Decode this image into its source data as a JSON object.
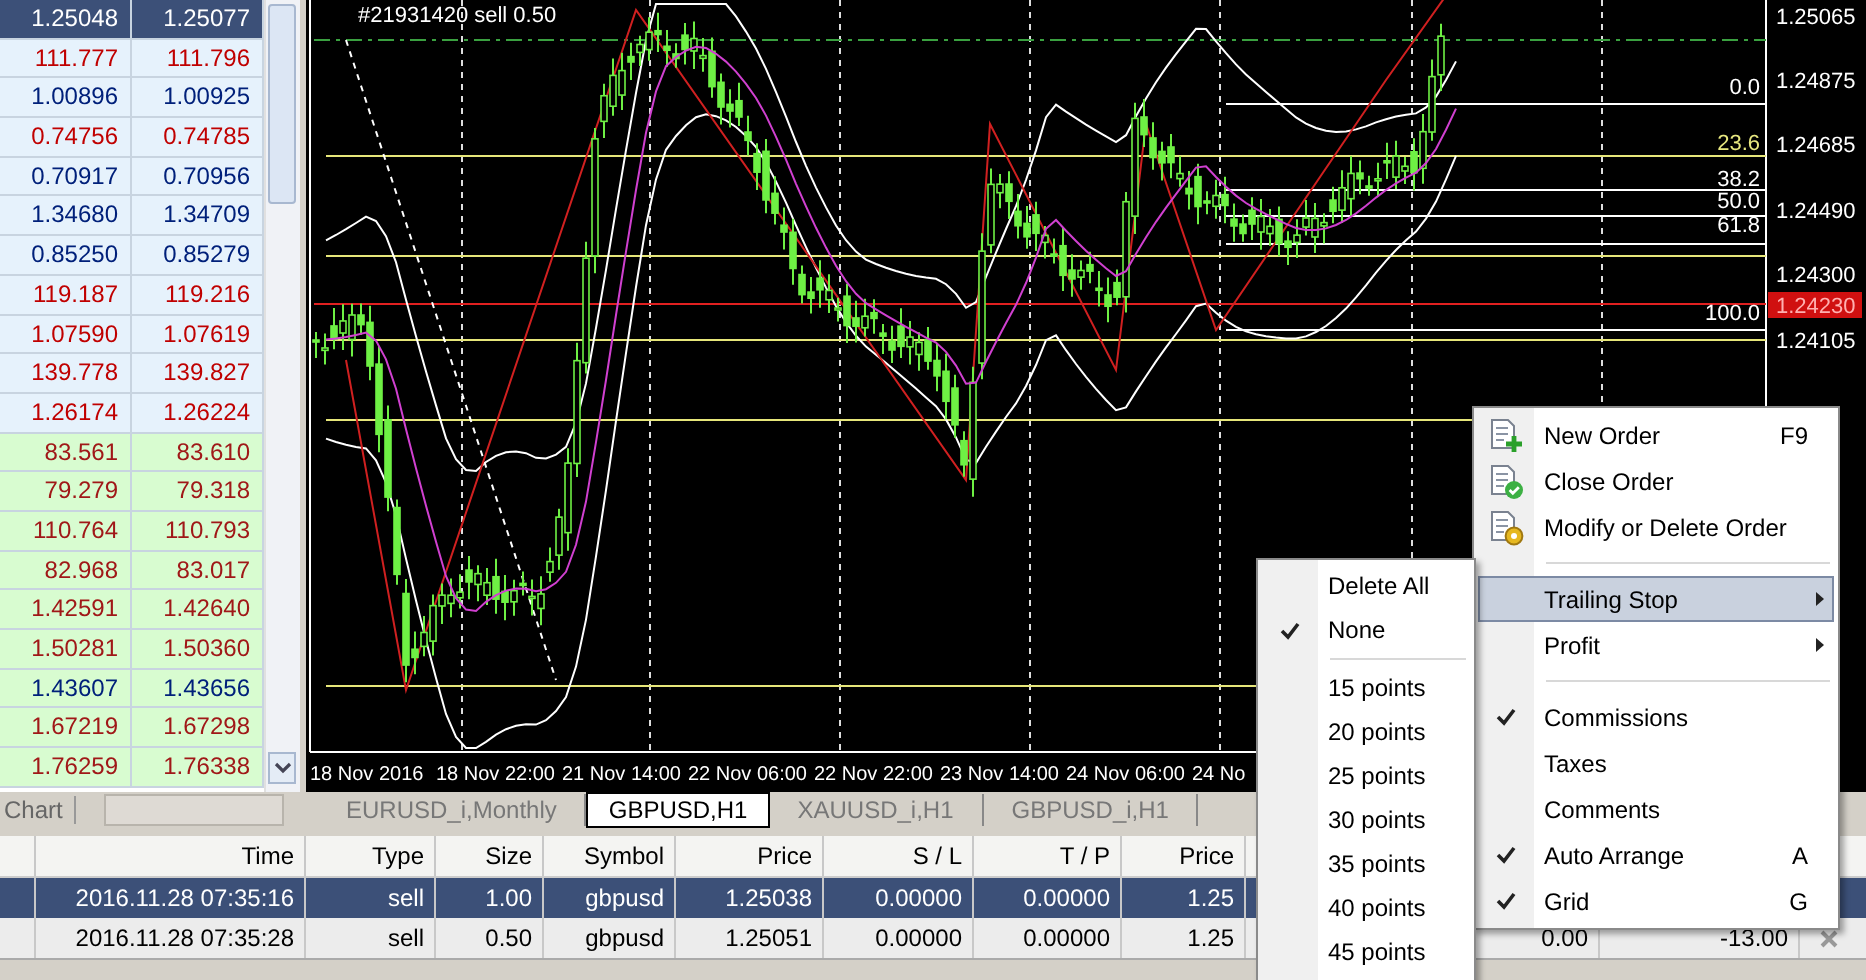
{
  "market_watch": {
    "quotes": [
      {
        "bid": "1.25048",
        "ask": "1.25077",
        "color": "#ffffff",
        "kind": "primary",
        "selected": true
      },
      {
        "bid": "111.777",
        "ask": "111.796",
        "color": "#c00000",
        "kind": "primary",
        "selected": false
      },
      {
        "bid": "1.00896",
        "ask": "1.00925",
        "color": "#00207a",
        "kind": "primary",
        "selected": false
      },
      {
        "bid": "0.74756",
        "ask": "0.74785",
        "color": "#c00000",
        "kind": "primary",
        "selected": false
      },
      {
        "bid": "0.70917",
        "ask": "0.70956",
        "color": "#00207a",
        "kind": "primary",
        "selected": false
      },
      {
        "bid": "1.34680",
        "ask": "1.34709",
        "color": "#00207a",
        "kind": "primary",
        "selected": false
      },
      {
        "bid": "0.85250",
        "ask": "0.85279",
        "color": "#00207a",
        "kind": "primary",
        "selected": false
      },
      {
        "bid": "119.187",
        "ask": "119.216",
        "color": "#c00000",
        "kind": "primary",
        "selected": false
      },
      {
        "bid": "1.07590",
        "ask": "1.07619",
        "color": "#c00000",
        "kind": "primary",
        "selected": false
      },
      {
        "bid": "139.778",
        "ask": "139.827",
        "color": "#c00000",
        "kind": "primary",
        "selected": false
      },
      {
        "bid": "1.26174",
        "ask": "1.26224",
        "color": "#c00000",
        "kind": "primary",
        "selected": false
      },
      {
        "bid": "83.561",
        "ask": "83.610",
        "color": "#a01818",
        "kind": "secondary",
        "selected": false
      },
      {
        "bid": "79.279",
        "ask": "79.318",
        "color": "#a01818",
        "kind": "secondary",
        "selected": false
      },
      {
        "bid": "110.764",
        "ask": "110.793",
        "color": "#a01818",
        "kind": "secondary",
        "selected": false
      },
      {
        "bid": "82.968",
        "ask": "83.017",
        "color": "#a01818",
        "kind": "secondary",
        "selected": false
      },
      {
        "bid": "1.42591",
        "ask": "1.42640",
        "color": "#a01818",
        "kind": "secondary",
        "selected": false
      },
      {
        "bid": "1.50281",
        "ask": "1.50360",
        "color": "#a01818",
        "kind": "secondary",
        "selected": false
      },
      {
        "bid": "1.43607",
        "ask": "1.43656",
        "color": "#00207a",
        "kind": "secondary",
        "selected": false
      },
      {
        "bid": "1.67219",
        "ask": "1.67298",
        "color": "#a01818",
        "kind": "secondary",
        "selected": false
      },
      {
        "bid": "1.76259",
        "ask": "1.76338",
        "color": "#a01818",
        "kind": "secondary",
        "selected": false
      }
    ],
    "tab": "Chart"
  },
  "chart": {
    "order_label": "#21931420 sell 0.50",
    "price_labels": [
      "1.25065",
      "1.24875",
      "1.24685",
      "1.24490",
      "1.24300",
      "1.24105"
    ],
    "current_price": "1.24230",
    "fib_labels": [
      {
        "text": "0.0",
        "color": "#ffffff"
      },
      {
        "text": "23.6",
        "color": "#e8e880"
      },
      {
        "text": "38.2",
        "color": "#ffffff"
      },
      {
        "text": "50.0",
        "color": "#ffffff"
      },
      {
        "text": "61.8",
        "color": "#ffffff"
      },
      {
        "text": "100.0",
        "color": "#ffffff"
      }
    ],
    "time_labels": [
      "18 Nov 2016",
      "18 Nov 22:00",
      "21 Nov 14:00",
      "22 Nov 06:00",
      "22 Nov 22:00",
      "23 Nov 14:00",
      "24 Nov 06:00",
      "24 No"
    ]
  },
  "chart_tabs": [
    {
      "label": "EURUSD_i,Monthly",
      "selected": false
    },
    {
      "label": "GBPUSD,H1",
      "selected": true
    },
    {
      "label": "XAUUSD_i,H1",
      "selected": false
    },
    {
      "label": "GBPUSD_i,H1",
      "selected": false
    }
  ],
  "terminal": {
    "columns": [
      "Time",
      "Type",
      "Size",
      "Symbol",
      "Price",
      "S / L",
      "T / P",
      "Price"
    ],
    "rows": [
      {
        "time": "2016.11.28 07:35:16",
        "type": "sell",
        "size": "1.00",
        "symbol": "gbpusd",
        "open_price": "1.25038",
        "sl": "0.00000",
        "tp": "0.00000",
        "price": "1.25",
        "selected": true
      },
      {
        "time": "2016.11.28 07:35:28",
        "type": "sell",
        "size": "0.50",
        "symbol": "gbpusd",
        "open_price": "1.25051",
        "sl": "0.00000",
        "tp": "0.00000",
        "price": "1.25",
        "column_9": "0.00",
        "column_10": "-13.00",
        "selected": false
      }
    ]
  },
  "context_menu": {
    "items": [
      {
        "kind": "item",
        "label": "New Order",
        "shortcut": "F9",
        "checked": false,
        "submenu": false,
        "selected": false
      },
      {
        "kind": "item",
        "label": "Close Order",
        "checked": false,
        "submenu": false,
        "selected": false
      },
      {
        "kind": "item",
        "label": "Modify or Delete Order",
        "checked": false,
        "submenu": false,
        "selected": false
      },
      {
        "kind": "separator"
      },
      {
        "kind": "item",
        "label": "Trailing Stop",
        "checked": false,
        "submenu": true,
        "selected": true
      },
      {
        "kind": "item",
        "label": "Profit",
        "checked": false,
        "submenu": true,
        "selected": false
      },
      {
        "kind": "separator"
      },
      {
        "kind": "item",
        "label": "Commissions",
        "checked": true,
        "submenu": false,
        "selected": false
      },
      {
        "kind": "item",
        "label": "Taxes",
        "checked": false,
        "submenu": false,
        "selected": false
      },
      {
        "kind": "item",
        "label": "Comments",
        "checked": false,
        "submenu": false,
        "selected": false
      },
      {
        "kind": "item",
        "label": "Auto Arrange",
        "shortcut": "A",
        "checked": true,
        "submenu": false,
        "selected": false
      },
      {
        "kind": "item",
        "label": "Grid",
        "shortcut": "G",
        "checked": true,
        "submenu": false,
        "selected": false
      }
    ]
  },
  "trailing_submenu": {
    "items": [
      {
        "kind": "item",
        "label": "Delete All",
        "checked": false
      },
      {
        "kind": "item",
        "label": "None",
        "checked": true
      },
      {
        "kind": "separator"
      },
      {
        "kind": "item",
        "label": "15 points",
        "checked": false
      },
      {
        "kind": "item",
        "label": "20 points",
        "checked": false
      },
      {
        "kind": "item",
        "label": "25 points",
        "checked": false
      },
      {
        "kind": "item",
        "label": "30 points",
        "checked": false
      },
      {
        "kind": "item",
        "label": "35 points",
        "checked": false
      },
      {
        "kind": "item",
        "label": "40 points",
        "checked": false
      },
      {
        "kind": "item",
        "label": "45 points",
        "checked": false
      }
    ]
  }
}
